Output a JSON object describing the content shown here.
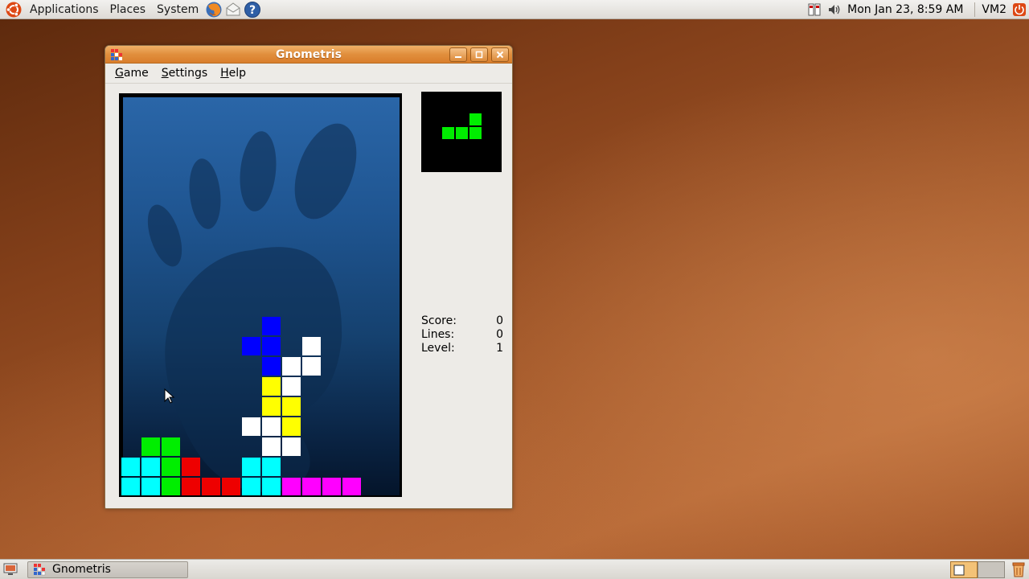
{
  "top_panel": {
    "menus": [
      "Applications",
      "Places",
      "System"
    ],
    "clock": "Mon Jan 23,  8:59 AM",
    "user": "VM2"
  },
  "window": {
    "title": "Gnometris",
    "menus": [
      {
        "label_u": "G",
        "label_rest": "ame"
      },
      {
        "label_u": "S",
        "label_rest": "ettings"
      },
      {
        "label_u": "H",
        "label_rest": "elp"
      }
    ]
  },
  "stats": {
    "score_label": "Score:",
    "score": "0",
    "lines_label": "Lines:",
    "lines": "0",
    "level_label": "Level:",
    "level": "1"
  },
  "taskbar": {
    "task_label": "Gnometris"
  },
  "colors": {
    "green": "#00ee00",
    "cyan": "#00ffff",
    "red": "#ee0000",
    "blue": "#0000ff",
    "white": "#ffffff",
    "yellow": "#ffff00",
    "magenta": "#ff00ff",
    "accent": "#e18f3d"
  },
  "board": {
    "columns": 14,
    "rows": 20,
    "blocks": [
      {
        "col": 7,
        "row": 11,
        "color": "blue"
      },
      {
        "col": 6,
        "row": 12,
        "color": "blue"
      },
      {
        "col": 7,
        "row": 12,
        "color": "blue"
      },
      {
        "col": 7,
        "row": 13,
        "color": "blue"
      },
      {
        "col": 9,
        "row": 12,
        "color": "white"
      },
      {
        "col": 8,
        "row": 13,
        "color": "white"
      },
      {
        "col": 9,
        "row": 13,
        "color": "white"
      },
      {
        "col": 8,
        "row": 14,
        "color": "white"
      },
      {
        "col": 7,
        "row": 14,
        "color": "yellow"
      },
      {
        "col": 7,
        "row": 15,
        "color": "yellow"
      },
      {
        "col": 8,
        "row": 15,
        "color": "yellow"
      },
      {
        "col": 8,
        "row": 16,
        "color": "yellow"
      },
      {
        "col": 6,
        "row": 16,
        "color": "white"
      },
      {
        "col": 7,
        "row": 16,
        "color": "white"
      },
      {
        "col": 7,
        "row": 17,
        "color": "white"
      },
      {
        "col": 8,
        "row": 17,
        "color": "white"
      },
      {
        "col": 1,
        "row": 17,
        "color": "green"
      },
      {
        "col": 2,
        "row": 17,
        "color": "green"
      },
      {
        "col": 0,
        "row": 18,
        "color": "cyan"
      },
      {
        "col": 1,
        "row": 18,
        "color": "cyan"
      },
      {
        "col": 2,
        "row": 18,
        "color": "green"
      },
      {
        "col": 3,
        "row": 18,
        "color": "red"
      },
      {
        "col": 6,
        "row": 18,
        "color": "cyan"
      },
      {
        "col": 7,
        "row": 18,
        "color": "cyan"
      },
      {
        "col": 0,
        "row": 19,
        "color": "cyan"
      },
      {
        "col": 1,
        "row": 19,
        "color": "cyan"
      },
      {
        "col": 2,
        "row": 19,
        "color": "green"
      },
      {
        "col": 3,
        "row": 19,
        "color": "red"
      },
      {
        "col": 4,
        "row": 19,
        "color": "red"
      },
      {
        "col": 5,
        "row": 19,
        "color": "red"
      },
      {
        "col": 6,
        "row": 19,
        "color": "cyan"
      },
      {
        "col": 7,
        "row": 19,
        "color": "cyan"
      },
      {
        "col": 8,
        "row": 19,
        "color": "magenta"
      },
      {
        "col": 9,
        "row": 19,
        "color": "magenta"
      },
      {
        "col": 10,
        "row": 19,
        "color": "magenta"
      },
      {
        "col": 11,
        "row": 19,
        "color": "magenta"
      }
    ]
  },
  "preview": {
    "columns": 3,
    "rows": 2,
    "blocks": [
      {
        "col": 2,
        "row": 0,
        "color": "green"
      },
      {
        "col": 0,
        "row": 1,
        "color": "green"
      },
      {
        "col": 1,
        "row": 1,
        "color": "green"
      },
      {
        "col": 2,
        "row": 1,
        "color": "green"
      }
    ]
  },
  "icons": {
    "distro_logo": "ubuntu-logo",
    "launchers": [
      "firefox-icon",
      "mail-icon",
      "help-icon"
    ],
    "tray": [
      "network-icon",
      "volume-icon",
      "shutdown-icon"
    ]
  }
}
